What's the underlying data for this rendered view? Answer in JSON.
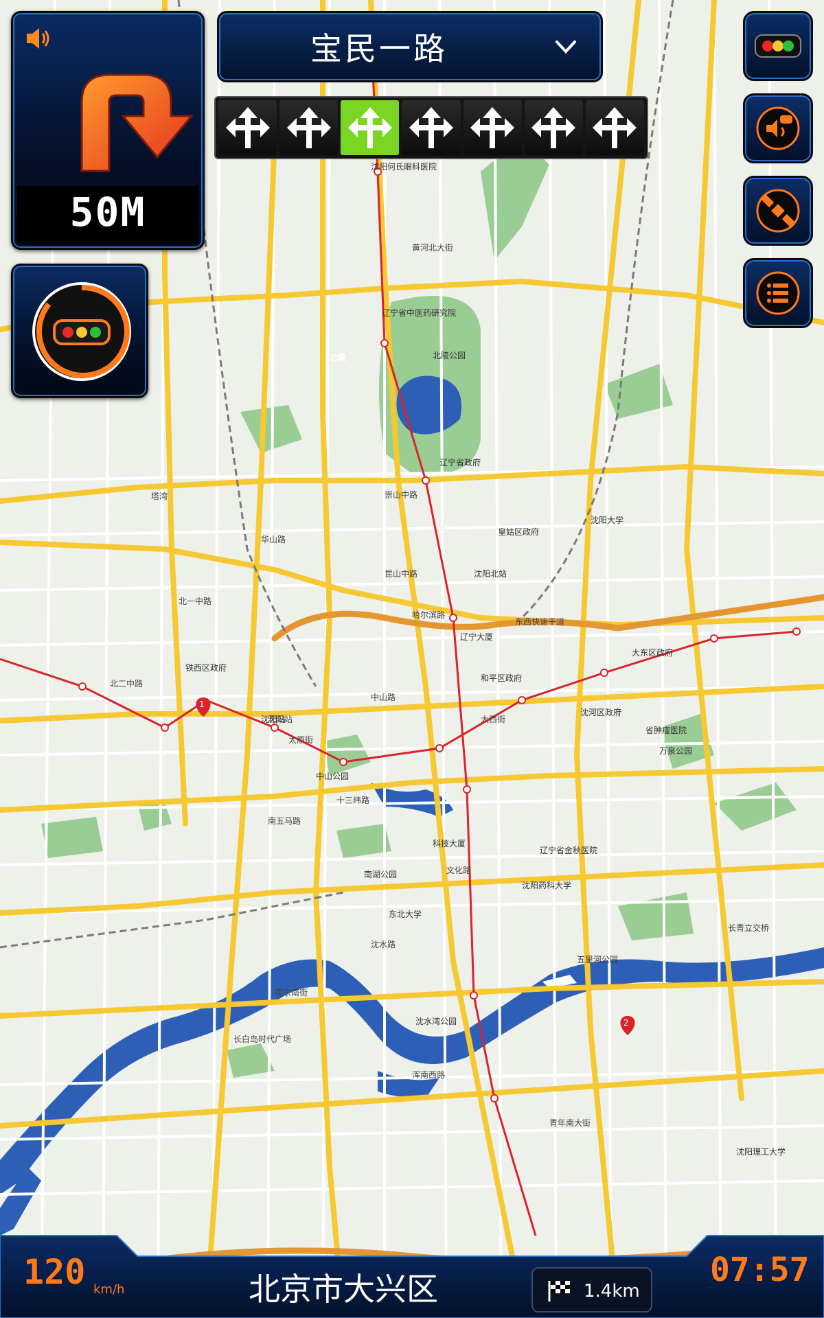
{
  "navigation": {
    "turn_distance": "50M",
    "road_name": "宝民一路",
    "lanes": [
      "straight-left-right",
      "straight-left-right",
      "straight-left-right",
      "straight-left-right",
      "straight-left-right",
      "straight-left-right",
      "straight-left-right"
    ],
    "active_lane": 2
  },
  "status_bar": {
    "speed": "120",
    "speed_unit": "km/h",
    "location": "北京市大兴区",
    "remaining_distance": "1.4km",
    "clock": "07:57"
  },
  "controls": {
    "right": [
      "traffic-light-icon",
      "voice-icon",
      "satellite-icon",
      "menu-icon"
    ]
  },
  "colors": {
    "panel": "#0b2b63",
    "accent_orange": "#ff7a1a",
    "lane_active": "#7ad622",
    "river": "#2c5fb5",
    "park": "#8fc98b",
    "road_major": "#f6c832",
    "road_minor": "#ffffff",
    "subway": "#d8242a"
  },
  "map": {
    "roads": [
      "宝民一路",
      "黄河北大街",
      "崇山中路",
      "北陵",
      "塔湾",
      "北一中路",
      "北二中路",
      "华山路",
      "昆山中路",
      "哈尔滨路",
      "东西快速干道",
      "中山路",
      "太原街",
      "大西街",
      "十三纬路",
      "南五马路",
      "文化路",
      "沈水路",
      "浑南西路",
      "长青立交桥",
      "长白岛时代广场",
      "沈阳站",
      "南京南街",
      "青年南大街"
    ],
    "places": [
      "北陵公园",
      "辽宁省政府",
      "沈阳北站",
      "沈阳大学",
      "辽宁大厦",
      "皇姑区政府",
      "铁西区政府",
      "沈河区政府",
      "大东区政府",
      "中山公园",
      "南湖公园",
      "五里河公园",
      "沈水湾公园",
      "和平区政府",
      "万泉公园",
      "省肿瘤医院",
      "辽宁省金秋医院",
      "沈阳药科大学",
      "沈阳何氏眼科医院",
      "辽宁省中医药研究院",
      "沈阳理工大学",
      "东北大学",
      "科技大厦",
      "沈阳站"
    ],
    "markers": [
      "1",
      "2"
    ]
  }
}
